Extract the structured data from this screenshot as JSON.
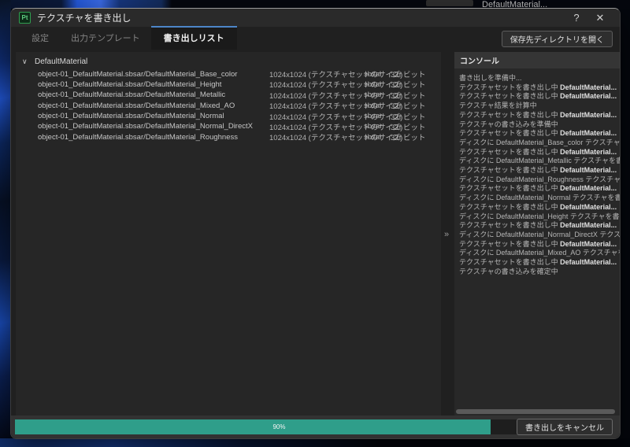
{
  "colors": {
    "accent": "#4d86c8",
    "progress_fill": "#2f9e8a"
  },
  "background": {
    "behind_app_text": "DefaultMaterial..."
  },
  "dialog": {
    "app_icon": "Pt",
    "title": "テクスチャを書き出し",
    "help_label": "?",
    "close_label": "✕",
    "tabs": [
      {
        "label": "設定",
        "active": false
      },
      {
        "label": "出力テンプレート",
        "active": false
      },
      {
        "label": "書き出しリスト",
        "active": true
      }
    ],
    "open_dir_button": "保存先ディレクトリを開く"
  },
  "export_list": {
    "chevron": "∨",
    "group": "DefaultMaterial",
    "rows": [
      {
        "name": "object-01_DefaultMaterial.sbsar/DefaultMaterial_Base_color",
        "size": "1024x1024 (テクスチャセットのサイズ)",
        "format": "sbsar",
        "depth": "32f ビット"
      },
      {
        "name": "object-01_DefaultMaterial.sbsar/DefaultMaterial_Height",
        "size": "1024x1024 (テクスチャセットのサイズ)",
        "format": "sbsar",
        "depth": "32f ビット"
      },
      {
        "name": "object-01_DefaultMaterial.sbsar/DefaultMaterial_Metallic",
        "size": "1024x1024 (テクスチャセットのサイズ)",
        "format": "sbsar",
        "depth": "32f ビット"
      },
      {
        "name": "object-01_DefaultMaterial.sbsar/DefaultMaterial_Mixed_AO",
        "size": "1024x1024 (テクスチャセットのサイズ)",
        "format": "sbsar",
        "depth": "32f ビット"
      },
      {
        "name": "object-01_DefaultMaterial.sbsar/DefaultMaterial_Normal",
        "size": "1024x1024 (テクスチャセットのサイズ)",
        "format": "sbsar",
        "depth": "32f ビット"
      },
      {
        "name": "object-01_DefaultMaterial.sbsar/DefaultMaterial_Normal_DirectX",
        "size": "1024x1024 (テクスチャセットのサイズ)",
        "format": "sbsar",
        "depth": "32f ビット"
      },
      {
        "name": "object-01_DefaultMaterial.sbsar/DefaultMaterial_Roughness",
        "size": "1024x1024 (テクスチャセットのサイズ)",
        "format": "sbsar",
        "depth": "32f ビット"
      }
    ]
  },
  "console": {
    "title": "コンソール",
    "collapse_icon": "»",
    "lines": [
      {
        "pre": "書き出しを準備中...",
        "bold": ""
      },
      {
        "pre": "テクスチャセットを書き出し中 ",
        "bold": "DefaultMaterial..."
      },
      {
        "pre": "テクスチャセットを書き出し中 ",
        "bold": "DefaultMaterial..."
      },
      {
        "pre": "テクスチャ結果を計算中",
        "bold": ""
      },
      {
        "pre": "テクスチャセットを書き出し中 ",
        "bold": "DefaultMaterial..."
      },
      {
        "pre": "テクスチャの書き込みを準備中",
        "bold": ""
      },
      {
        "pre": "テクスチャセットを書き出し中 ",
        "bold": "DefaultMaterial..."
      },
      {
        "pre": "ディスクに DefaultMaterial_Base_color テクスチャを書き込み中",
        "bold": ""
      },
      {
        "pre": "テクスチャセットを書き出し中 ",
        "bold": "DefaultMaterial..."
      },
      {
        "pre": "ディスクに DefaultMaterial_Metallic テクスチャを書き込み中",
        "bold": ""
      },
      {
        "pre": "テクスチャセットを書き出し中 ",
        "bold": "DefaultMaterial..."
      },
      {
        "pre": "ディスクに DefaultMaterial_Roughness テクスチャを書き込み中",
        "bold": ""
      },
      {
        "pre": "テクスチャセットを書き出し中 ",
        "bold": "DefaultMaterial..."
      },
      {
        "pre": "ディスクに DefaultMaterial_Normal テクスチャを書き込み中",
        "bold": ""
      },
      {
        "pre": "テクスチャセットを書き出し中 ",
        "bold": "DefaultMaterial..."
      },
      {
        "pre": "ディスクに DefaultMaterial_Height テクスチャを書き込み中",
        "bold": ""
      },
      {
        "pre": "テクスチャセットを書き出し中 ",
        "bold": "DefaultMaterial..."
      },
      {
        "pre": "ディスクに DefaultMaterial_Normal_DirectX テクスチャを書き込み中",
        "bold": ""
      },
      {
        "pre": "テクスチャセットを書き出し中 ",
        "bold": "DefaultMaterial..."
      },
      {
        "pre": "ディスクに DefaultMaterial_Mixed_AO テクスチャを書き込み中",
        "bold": ""
      },
      {
        "pre": "テクスチャセットを書き出し中 ",
        "bold": "DefaultMaterial..."
      },
      {
        "pre": "テクスチャの書き込みを確定中",
        "bold": ""
      }
    ]
  },
  "footer": {
    "progress_label": "90%",
    "progress_value": 90,
    "cancel_button": "書き出しをキャンセル"
  }
}
